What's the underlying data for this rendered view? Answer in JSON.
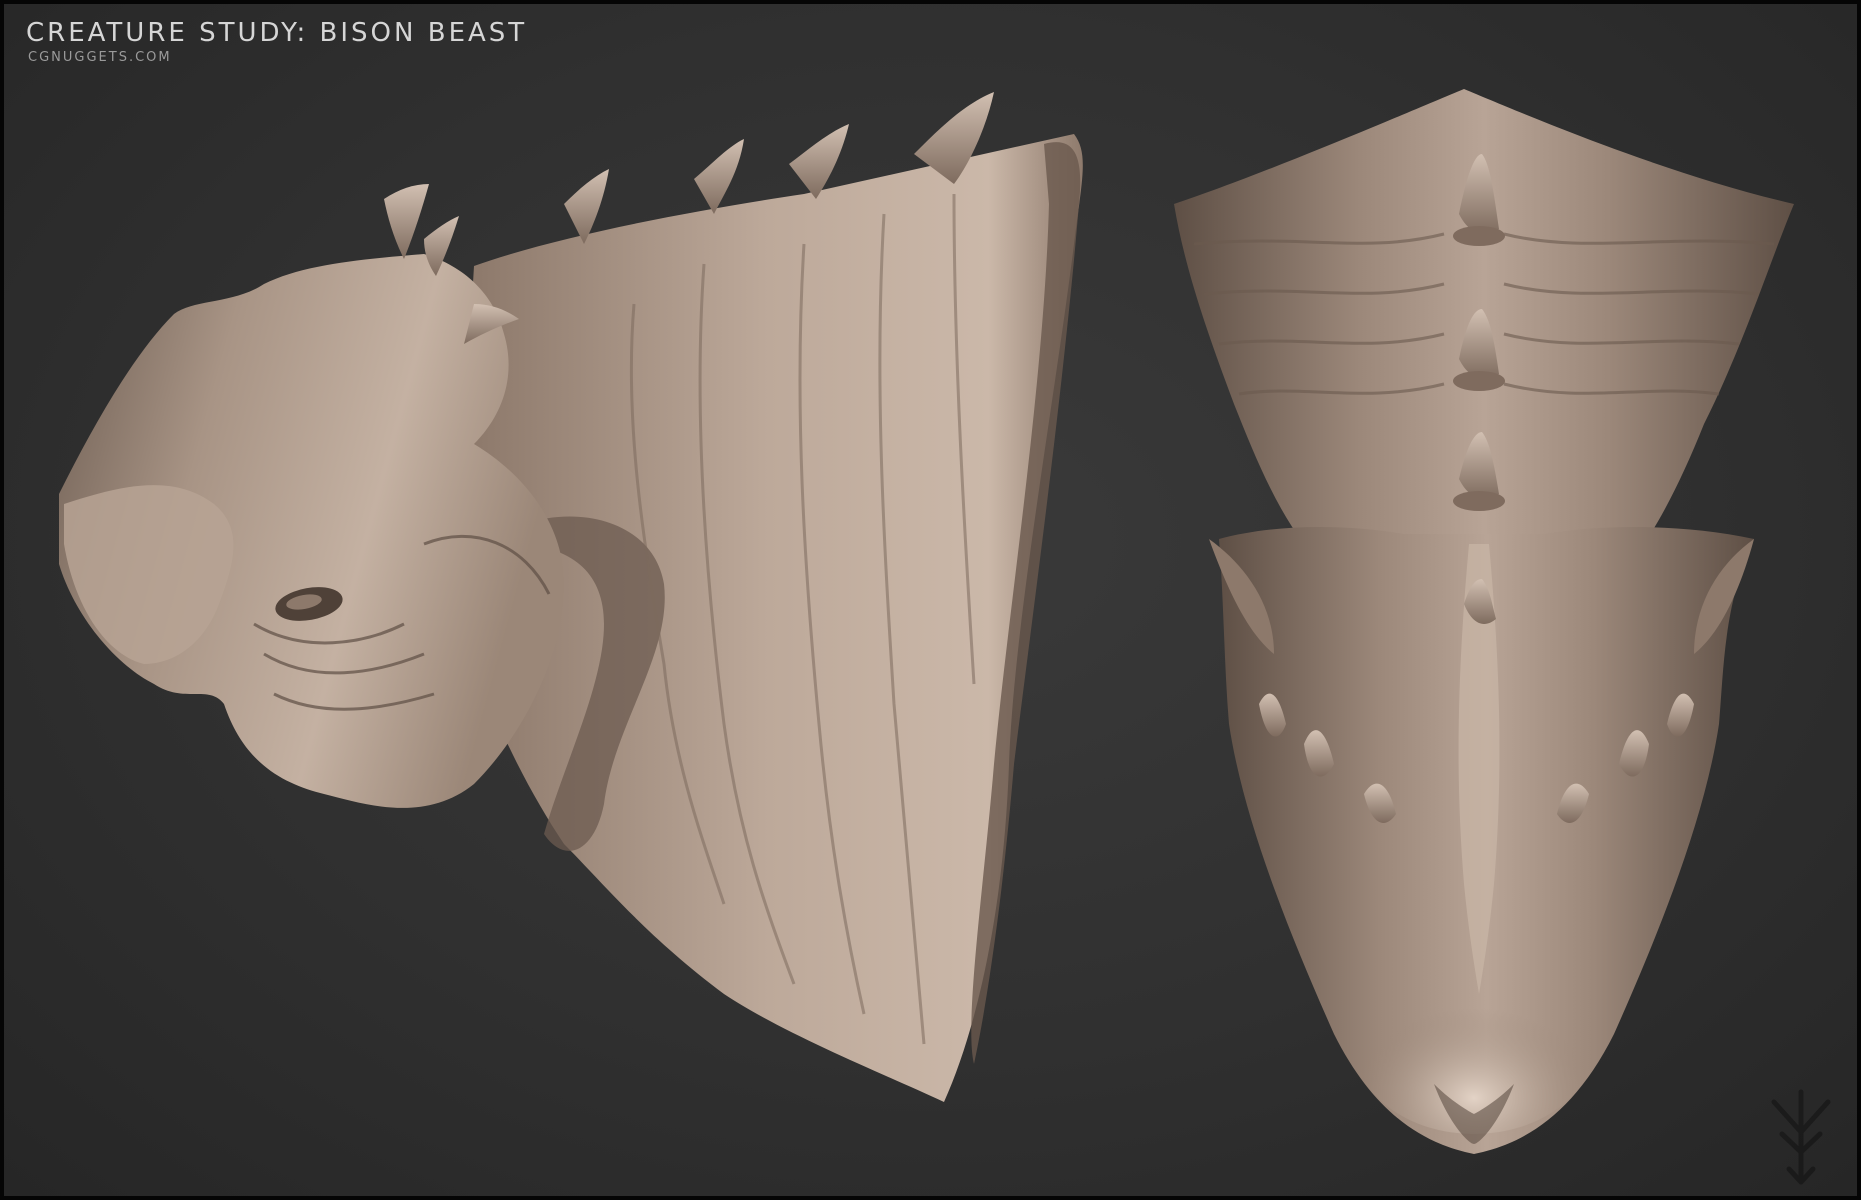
{
  "header": {
    "title": "CREATURE STUDY: BISON BEAST",
    "subtitle": "CGNUGGETS.COM"
  },
  "colors": {
    "background": "#333333",
    "border": "#050505",
    "clay_light": "#c2aea0",
    "clay_mid": "#9a8677",
    "clay_dark": "#5e4f45",
    "title_text": "#d6d6d6"
  },
  "images": [
    {
      "name": "bison-beast-side-view",
      "description": "Clay sculpt of horned creature head and neck, three-quarter side view"
    },
    {
      "name": "bison-beast-top-view",
      "description": "Clay sculpt of the same creature seen from above with central horn ridge"
    }
  ],
  "logo": {
    "icon": "trident-arrow-logo-icon"
  }
}
